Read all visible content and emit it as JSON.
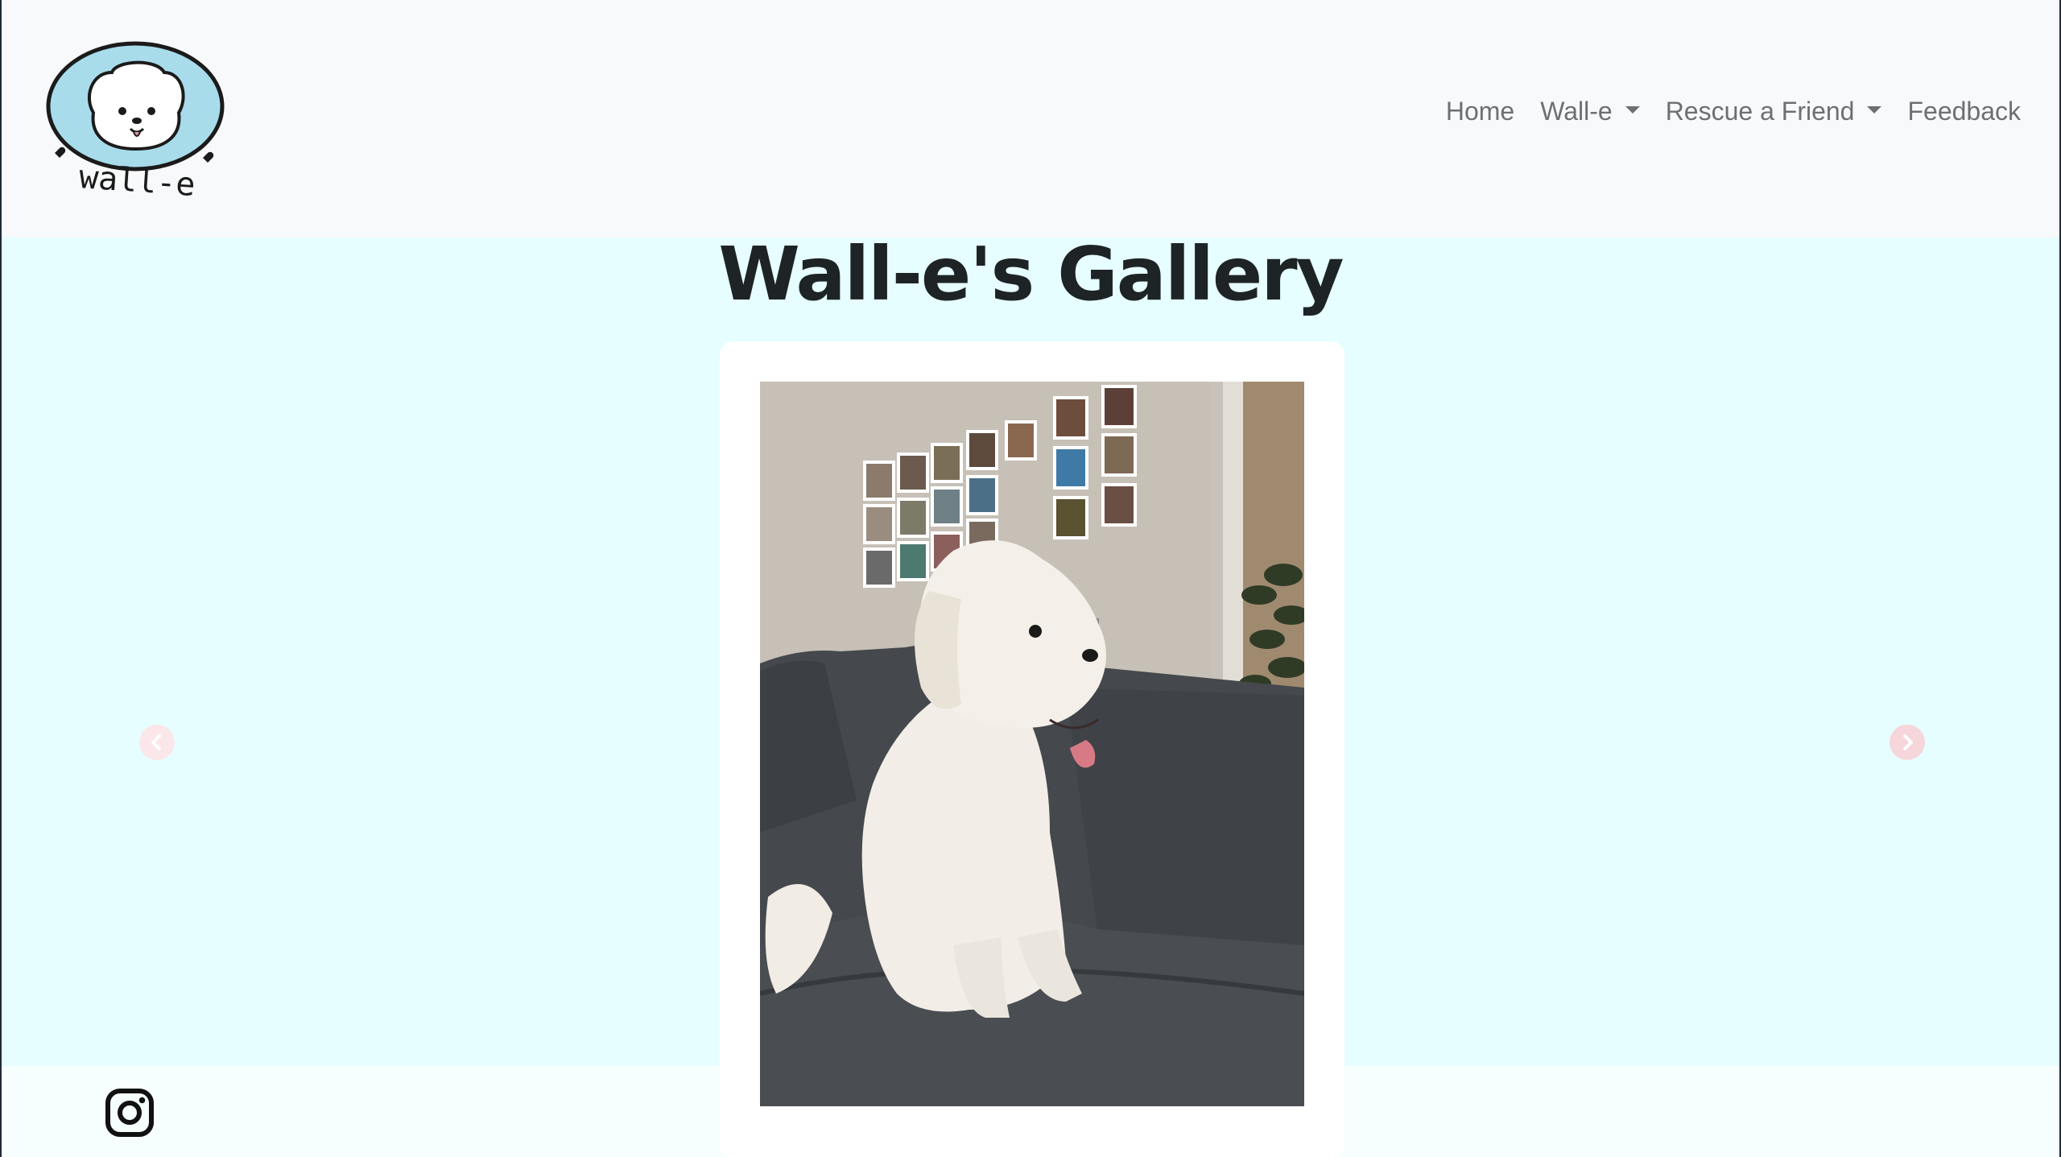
{
  "brand": {
    "logo_text": "wall-e"
  },
  "nav": {
    "items": [
      {
        "label": "Home",
        "dropdown": false
      },
      {
        "label": "Wall-e",
        "dropdown": true
      },
      {
        "label": "Rescue a Friend",
        "dropdown": true
      },
      {
        "label": "Feedback",
        "dropdown": false
      }
    ]
  },
  "main": {
    "title": "Wall-e's Gallery"
  },
  "carousel": {
    "prev_icon": "chevron-left-icon",
    "next_icon": "chevron-right-icon"
  },
  "footer": {
    "social_icon": "instagram-icon"
  },
  "colors": {
    "background": "#e6feff",
    "navbar": "#f8f9fa",
    "nav_text": "#6c6f73",
    "title": "#1e2326",
    "arrow": "#f6d5db",
    "logo_fill": "#a8dcea"
  }
}
